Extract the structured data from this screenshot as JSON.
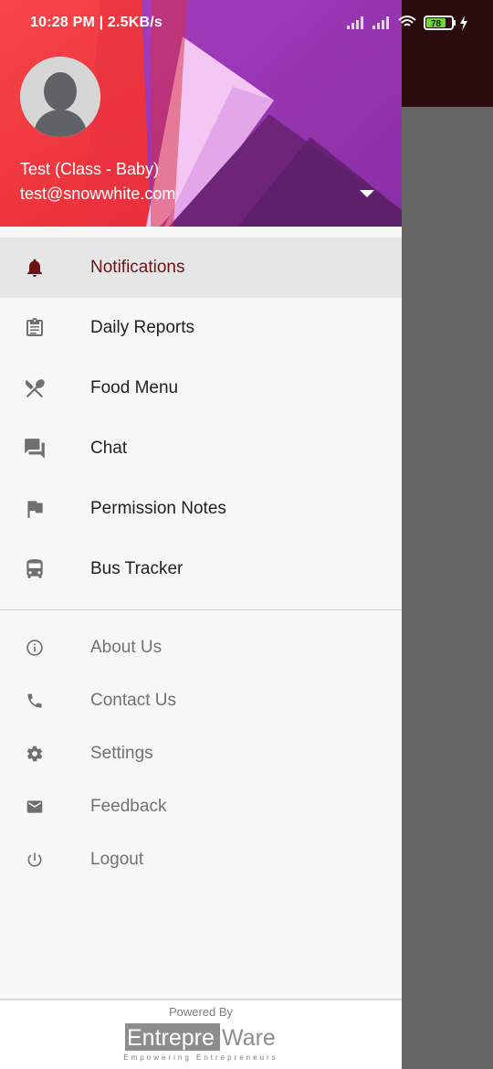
{
  "status_bar": {
    "time": "10:28 PM | 2.5KB/s",
    "battery": "78"
  },
  "header": {
    "user_name": "Test (Class - Baby)",
    "user_email": "test@snowwhite.com"
  },
  "menu": {
    "primary": [
      {
        "label": "Notifications",
        "icon": "bell-icon",
        "active": true
      },
      {
        "label": "Daily Reports",
        "icon": "clipboard-icon"
      },
      {
        "label": "Food Menu",
        "icon": "utensils-icon"
      },
      {
        "label": "Chat",
        "icon": "chat-icon"
      },
      {
        "label": "Permission Notes",
        "icon": "flag-icon"
      },
      {
        "label": "Bus Tracker",
        "icon": "bus-icon"
      }
    ],
    "secondary": [
      {
        "label": "About Us",
        "icon": "info-icon"
      },
      {
        "label": "Contact Us",
        "icon": "phone-icon"
      },
      {
        "label": "Settings",
        "icon": "gear-icon"
      },
      {
        "label": "Feedback",
        "icon": "mail-icon"
      },
      {
        "label": "Logout",
        "icon": "power-icon"
      }
    ]
  },
  "footer": {
    "powered_by": "Powered By",
    "brand_part1": "Entrepre",
    "brand_part2": "Ware",
    "tagline": "Empowering Entrepreneurs"
  },
  "colors": {
    "active_label": "#6a1416",
    "active_icon": "#6a1416",
    "icon_gray": "#6f6f6f",
    "header_red": "#f2373a",
    "header_purple": "#9c35b5"
  }
}
